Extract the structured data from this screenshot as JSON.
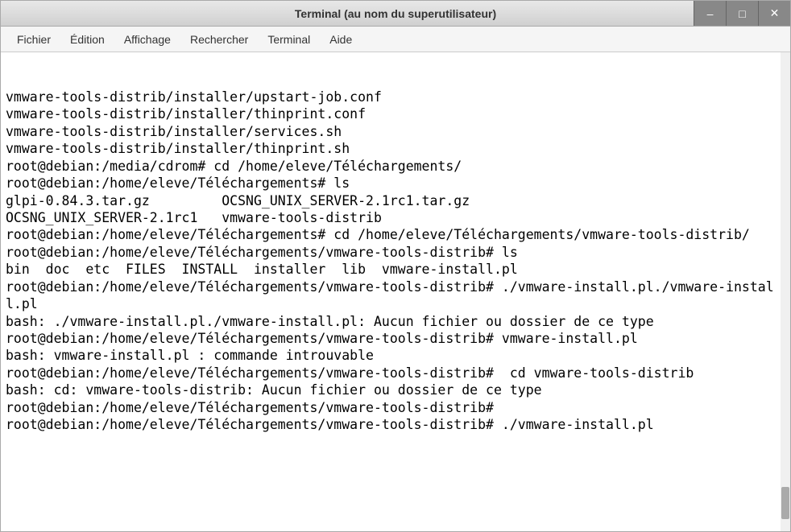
{
  "window": {
    "title": "Terminal (au nom du superutilisateur)"
  },
  "menubar": {
    "items": [
      "Fichier",
      "Édition",
      "Affichage",
      "Rechercher",
      "Terminal",
      "Aide"
    ]
  },
  "terminal": {
    "lines": [
      "vmware-tools-distrib/installer/upstart-job.conf",
      "vmware-tools-distrib/installer/thinprint.conf",
      "vmware-tools-distrib/installer/services.sh",
      "vmware-tools-distrib/installer/thinprint.sh",
      "root@debian:/media/cdrom# cd /home/eleve/Téléchargements/",
      "root@debian:/home/eleve/Téléchargements# ls",
      "glpi-0.84.3.tar.gz         OCSNG_UNIX_SERVER-2.1rc1.tar.gz",
      "OCSNG_UNIX_SERVER-2.1rc1   vmware-tools-distrib",
      "root@debian:/home/eleve/Téléchargements# cd /home/eleve/Téléchargements/vmware-tools-distrib/",
      "root@debian:/home/eleve/Téléchargements/vmware-tools-distrib# ls",
      "bin  doc  etc  FILES  INSTALL  installer  lib  vmware-install.pl",
      "root@debian:/home/eleve/Téléchargements/vmware-tools-distrib# ./vmware-install.pl./vmware-install.pl",
      "bash: ./vmware-install.pl./vmware-install.pl: Aucun fichier ou dossier de ce type",
      "root@debian:/home/eleve/Téléchargements/vmware-tools-distrib# vmware-install.pl",
      "bash: vmware-install.pl : commande introuvable",
      "root@debian:/home/eleve/Téléchargements/vmware-tools-distrib#  cd vmware-tools-distrib",
      "bash: cd: vmware-tools-distrib: Aucun fichier ou dossier de ce type",
      "root@debian:/home/eleve/Téléchargements/vmware-tools-distrib#",
      "root@debian:/home/eleve/Téléchargements/vmware-tools-distrib# ./vmware-install.pl"
    ]
  },
  "window_controls": {
    "minimize": "–",
    "maximize": "□",
    "close": "✕"
  }
}
